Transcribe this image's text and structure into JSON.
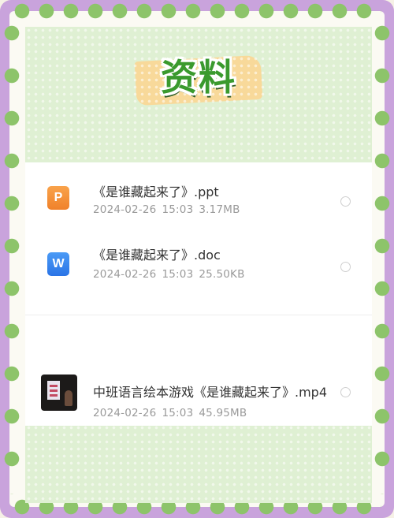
{
  "header": {
    "title": "资料"
  },
  "files": [
    {
      "name": "《是谁藏起来了》.ppt",
      "date": "2024-02-26",
      "time": "15:03",
      "size": "3.17MB",
      "type_icon": "ppt-file-icon",
      "icon_letter": "P",
      "color": "#f48c33"
    },
    {
      "name": "《是谁藏起来了》.doc",
      "date": "2024-02-26",
      "time": "15:03",
      "size": "25.50KB",
      "type_icon": "word-file-icon",
      "icon_letter": "W",
      "color": "#3b87ee"
    },
    {
      "name": "中班语言绘本游戏《是谁藏起来了》.mp4",
      "date": "2024-02-26",
      "time": "15:03",
      "size": "45.95MB",
      "type_icon": "video-thumbnail"
    }
  ],
  "colors": {
    "frame": "#c9a3dc",
    "dots": "#8dc46a",
    "panel": "#dff0d3",
    "title": "#3a9a2e"
  }
}
